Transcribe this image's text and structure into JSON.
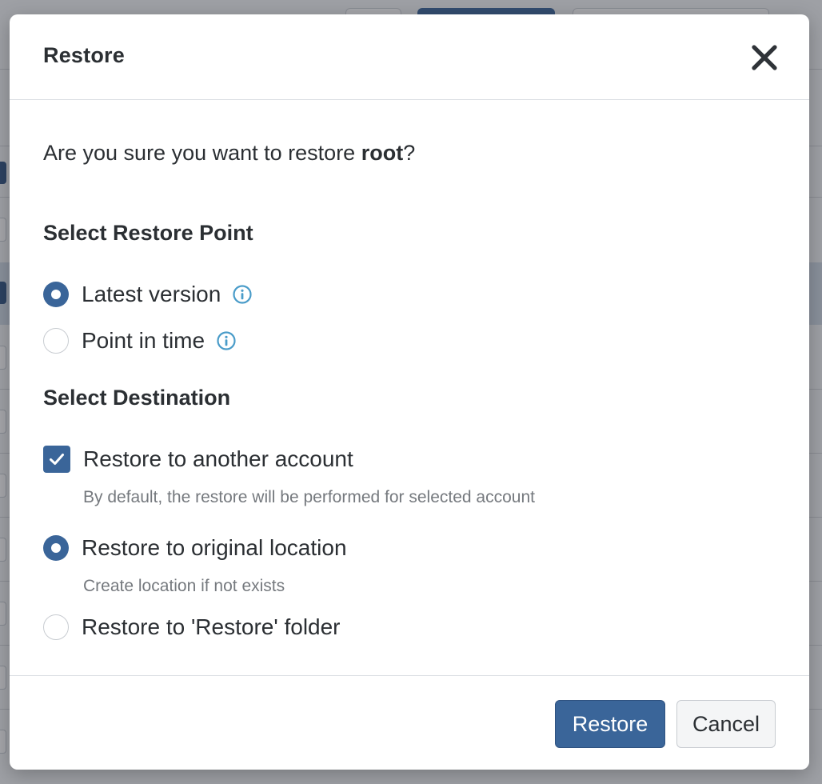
{
  "modal": {
    "title": "Restore",
    "question_prefix": "Are you sure you want to restore ",
    "question_target": "root",
    "question_suffix": "?"
  },
  "restore_point": {
    "section_title": "Select Restore Point",
    "options": [
      {
        "label": "Latest version",
        "selected": true,
        "icon": "info-icon"
      },
      {
        "label": "Point in time",
        "selected": false,
        "icon": "info-icon"
      }
    ]
  },
  "destination": {
    "section_title": "Select Destination",
    "another_account": {
      "label": "Restore to another account",
      "checked": true,
      "hint": "By default, the restore will be performed for selected account"
    },
    "original_location": {
      "label": "Restore to original location",
      "selected": true,
      "hint": "Create location if not exists"
    },
    "restore_folder": {
      "label": "Restore to 'Restore' folder",
      "selected": false
    }
  },
  "footer": {
    "restore_label": "Restore",
    "cancel_label": "Cancel"
  },
  "colors": {
    "primary": "#3a6599",
    "info": "#4a9cc9",
    "text": "#2b2f33",
    "muted": "#75797e"
  }
}
